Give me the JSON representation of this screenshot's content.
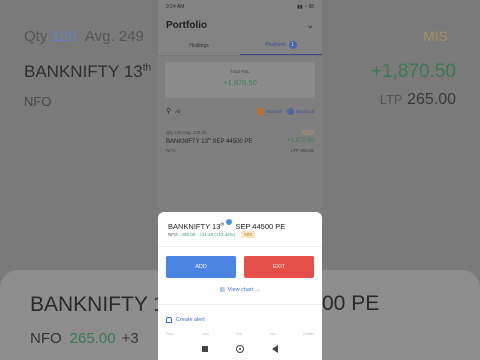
{
  "background": {
    "qty_label": "Qty",
    "qty_value": "120",
    "avg_label": "Avg.",
    "avg_value": "249",
    "product_tag": "MIS",
    "instrument": "BANKNIFTY 13",
    "instrument_sup": "th",
    "pnl": "+1,870.50",
    "exchange": "NFO",
    "ltp_label": "LTP",
    "ltp_value": "265.00",
    "sheet_instrument": "BANKNIFTY 13",
    "sheet_instrument_sup": "th",
    "sheet_instrument_right": "00 PE",
    "sheet_exchange": "NFO",
    "sheet_ltp": "265.00",
    "sheet_change": "+3"
  },
  "status_bar": {
    "time": "9:24 AM",
    "battery": "98"
  },
  "header": {
    "title": "Portfolio"
  },
  "tabs": [
    {
      "label": "Holdings"
    },
    {
      "label": "Positions",
      "count": "1"
    }
  ],
  "pnl_card": {
    "label": "Total P&L",
    "value": "+1,870.50"
  },
  "search": {
    "placeholder": "All",
    "analyse_label": "Analyse",
    "sensibull_label": "Sensibull"
  },
  "position": {
    "qty": "Qty 120 Avg. 249.41",
    "product": "MIS",
    "name": "BANKNIFTY 13",
    "name_sup": "th",
    "name_rest": "SEP 44500 PE",
    "pnl": "+1,870.50",
    "exchange": "NFO",
    "ltp": "LTP 265.00"
  },
  "sheet": {
    "name": "BANKNIFTY 13",
    "name_sup": "th",
    "name_rest": "SEP 44500 PE",
    "exchange": "NFO",
    "ltp": "265.00",
    "change": "+31.40 (+13.44%)",
    "product": "MIS",
    "add_label": "ADD",
    "exit_label": "EXIT",
    "view_chart_label": "View chart",
    "create_alert_label": "Create alert",
    "faint_items": [
      "Place",
      "Add",
      "Exit",
      "Info",
      "Details"
    ]
  },
  "colors": {
    "accent": "#4c84e4",
    "exit": "#e45047",
    "profit": "#43a06a",
    "mis_tag": "#fbe7c4"
  }
}
